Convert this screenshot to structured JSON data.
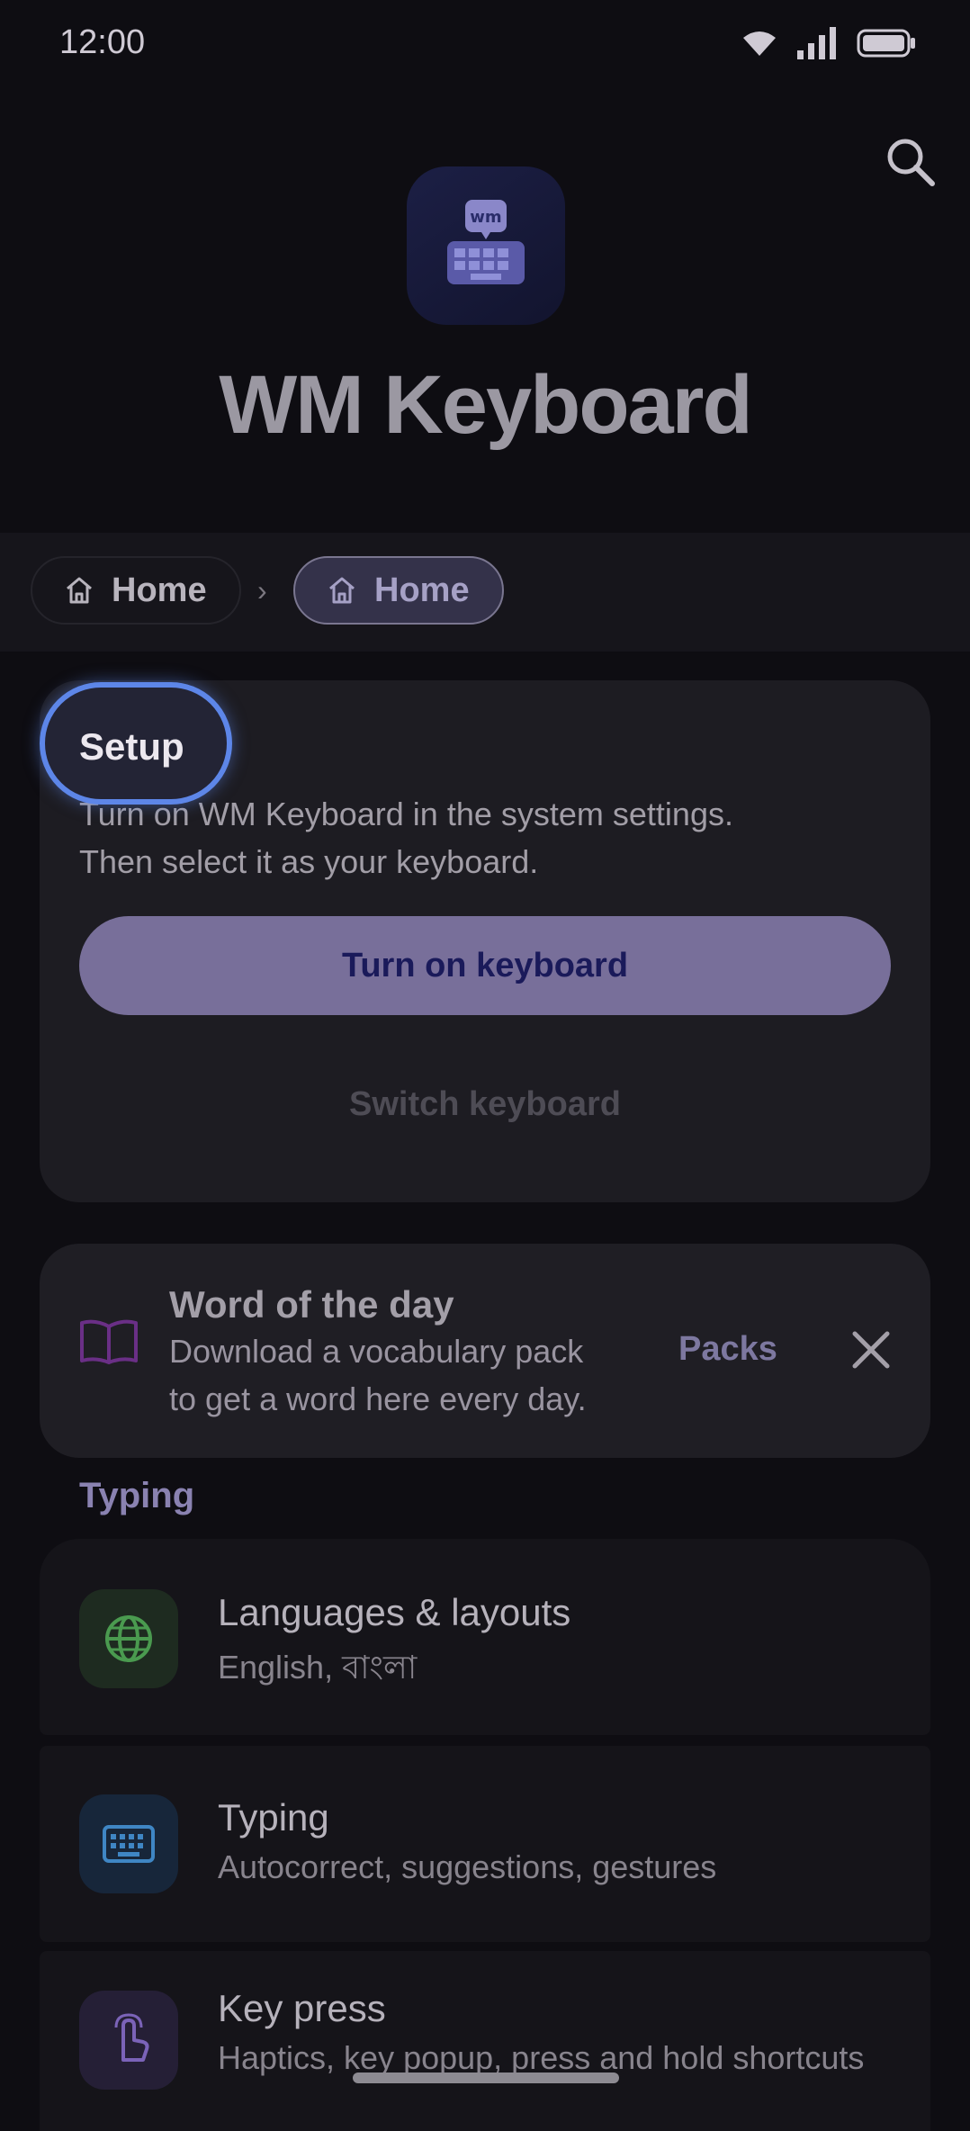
{
  "status_bar": {
    "time": "12:00"
  },
  "app": {
    "title": "WM Keyboard",
    "logo_text": "wm"
  },
  "breadcrumb": {
    "items": [
      {
        "label": "Home"
      },
      {
        "label": "Home"
      }
    ],
    "separator": "›"
  },
  "setup": {
    "title": "Setup",
    "description_line1": "Turn on WM Keyboard in the system settings.",
    "description_line2": "Then select it as your keyboard.",
    "primary_button": "Turn on keyboard",
    "secondary_button": "Switch keyboard"
  },
  "word_of_the_day": {
    "title": "Word of the day",
    "description_line1": "Download a vocabulary pack",
    "description_line2": "to get a word here every day.",
    "action": "Packs"
  },
  "typing_section": {
    "label": "Typing",
    "items": [
      {
        "title": "Languages & layouts",
        "subtitle": "English, বাংলা",
        "icon": "globe-icon",
        "color": "#4a9a4f"
      },
      {
        "title": "Typing",
        "subtitle": "Autocorrect, suggestions, gestures",
        "icon": "keyboard-icon",
        "color": "#3f86c4"
      },
      {
        "title": "Key press",
        "subtitle": "Haptics, key popup, press and hold shortcuts",
        "icon": "touch-icon",
        "color": "#7b63b8"
      }
    ]
  },
  "colors": {
    "accent": "#786f9a",
    "focus": "#5d86e8",
    "background": "#0e0d12"
  }
}
